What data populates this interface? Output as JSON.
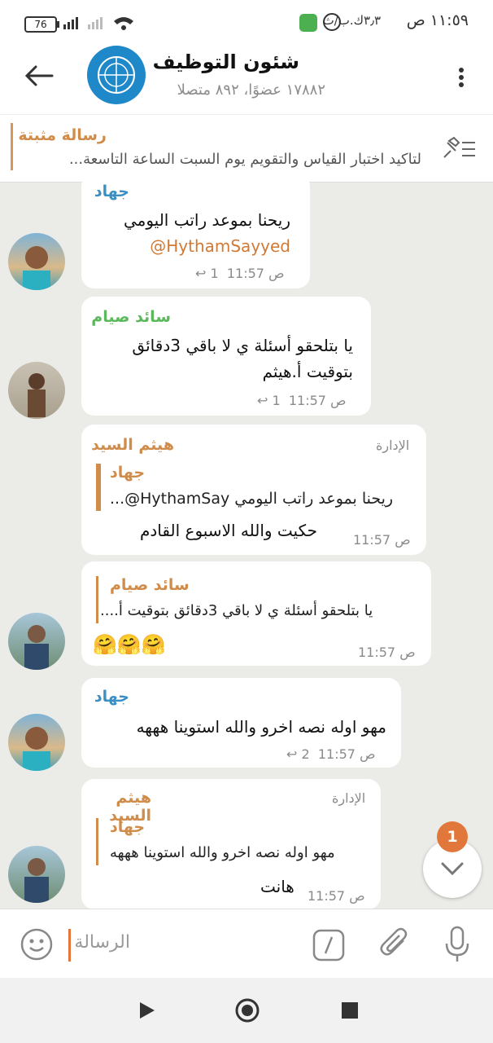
{
  "status": {
    "time": "١١:٥٩ ص",
    "speed": "٣٫٣ك.ب/ث",
    "battery": "76"
  },
  "header": {
    "title": "شئون التوظيف",
    "subtitle": "١٧٨٨٢ عضوًا، ٨٩٢ متصلا"
  },
  "pinned": {
    "label": "رسالة مثبتة",
    "text": "لتاكيد اختبار القياس والتقويم يوم السبت الساعة التاسعة..."
  },
  "messages": [
    {
      "sender": "جهاد",
      "line1": "ريحنا بموعد راتب اليومي",
      "line2": "HythamSayyed@",
      "time": "11:57 ص",
      "replies": "1"
    },
    {
      "sender": "سائد صيام",
      "line1": "يا بتلحقو أسئلة ي لا باقي 3دقائق",
      "line2": "بتوقيت أ.هيثم",
      "time": "11:57 ص",
      "replies": "1"
    },
    {
      "sender": "هيثم السيد",
      "role": "الإدارة",
      "quote_name": "جهاد",
      "quote_text": "ريحنا بموعد راتب اليومي HythamSay@...",
      "body": "حكيت والله الاسبوع القادم",
      "time": "11:57 ص"
    },
    {
      "quote_name": "سائد صيام",
      "quote_text": "يا بتلحقو أسئلة ي لا باقي 3دقائق بتوقيت أ....",
      "body": "🤗🤗🤗",
      "time": "11:57 ص"
    },
    {
      "sender": "جهاد",
      "body": "مهو اوله نصه اخرو والله استوينا هههه",
      "time": "11:57 ص",
      "replies": "2"
    },
    {
      "sender": "هيثم السيد",
      "role": "الإدارة",
      "quote_name": "جهاد",
      "quote_text": "مهو اوله نصه اخرو والله استوينا هههه",
      "body": "هانت",
      "time": "11:57 ص"
    }
  ],
  "fab": {
    "badge": "1"
  },
  "composer": {
    "placeholder": "الرسالة"
  },
  "colors": {
    "accent": "#d08c4a",
    "green_name": "#5cb85c",
    "blue_name": "#3a8fc4",
    "badge": "#e2773b"
  }
}
